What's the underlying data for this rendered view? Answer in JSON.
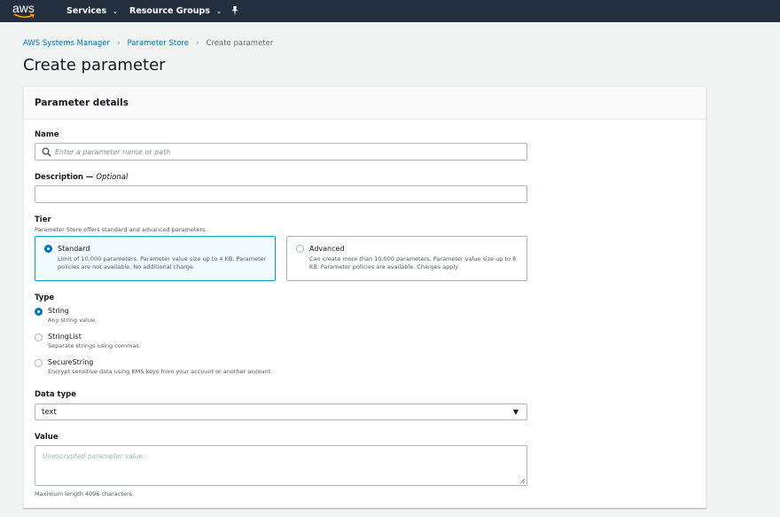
{
  "topnav": {
    "logo": "aws",
    "services_label": "Services",
    "resource_groups_label": "Resource Groups",
    "caret": "⌄",
    "pin_icon": "pin-icon"
  },
  "breadcrumb": {
    "items": [
      "AWS Systems Manager",
      "Parameter Store",
      "Create parameter"
    ],
    "separator": "›"
  },
  "page": {
    "title": "Create parameter"
  },
  "panel": {
    "title": "Parameter details",
    "name": {
      "label": "Name",
      "placeholder": "Enter a parameter name or path"
    },
    "description": {
      "label": "Description — ",
      "optional": "Optional",
      "value": ""
    },
    "tier": {
      "label": "Tier",
      "sublabel": "Parameter Store offers standard and advanced parameters.",
      "options": [
        {
          "title": "Standard",
          "desc": "Limit of 10,000 parameters. Parameter value size up to 4 KB. Parameter policies are not available. No additional charge.",
          "selected": true
        },
        {
          "title": "Advanced",
          "desc": "Can create more than 10,000 parameters. Parameter value size up to 8 KB. Parameter policies are available. Charges apply",
          "selected": false
        }
      ]
    },
    "type": {
      "label": "Type",
      "options": [
        {
          "title": "String",
          "desc": "Any string value.",
          "selected": true
        },
        {
          "title": "StringList",
          "desc": "Separate strings using commas.",
          "selected": false
        },
        {
          "title": "SecureString",
          "desc": "Encrypt sensitive data using KMS keys from your account or another account.",
          "selected": false
        }
      ]
    },
    "data_type": {
      "label": "Data type",
      "value": "text",
      "caret": "▼"
    },
    "value": {
      "label": "Value",
      "placeholder": "Unencrypted parameter value.",
      "hint": "Maximum length 4096 characters."
    }
  },
  "colors": {
    "nav_bg": "#232f3e",
    "link": "#0073bb",
    "selected_border": "#00a1c9",
    "selected_bg": "#f1faff",
    "aws_orange": "#ff9900"
  }
}
